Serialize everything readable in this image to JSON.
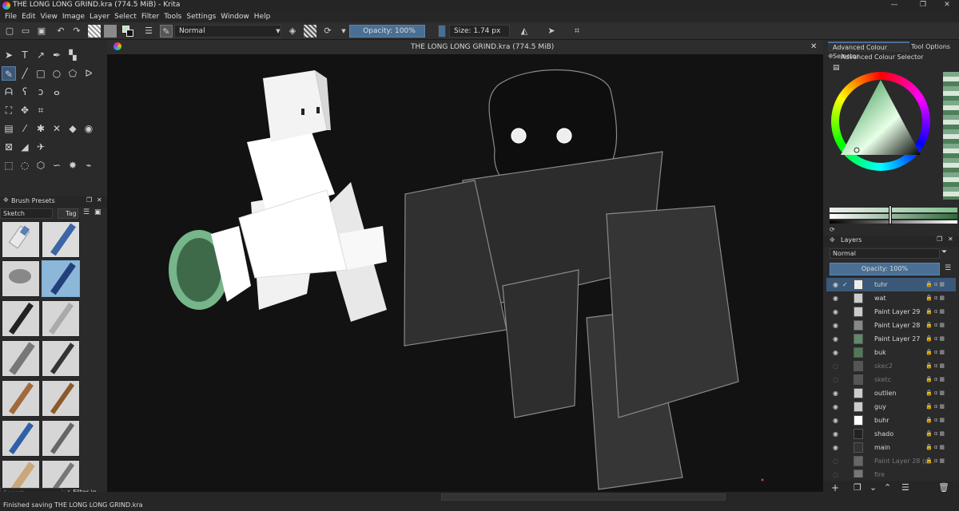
{
  "window": {
    "title": "THE LONG LONG GRIND.kra (774.5 MiB)  - Krita",
    "min_icon": "—",
    "max_icon": "❐",
    "close_icon": "✕"
  },
  "menu": [
    "File",
    "Edit",
    "View",
    "Image",
    "Layer",
    "Select",
    "Filter",
    "Tools",
    "Settings",
    "Window",
    "Help"
  ],
  "toolbar": {
    "blend_mode": "Normal",
    "opacity_label": "Opacity: 100%",
    "size_label": "Size: 1.74 px"
  },
  "canvas": {
    "doc_title": "THE LONG LONG GRIND.kra (774.5 MiB)",
    "close": "✕"
  },
  "brush_presets": {
    "title": "Brush Presets",
    "tag_select": "Sketch",
    "tag_label": "Tag",
    "search_placeholder": "Search",
    "filter_in_tag": "Filter in Tag"
  },
  "colour": {
    "tab_active": "Advanced Colour Selector",
    "tab_other": "Tool Options",
    "panel_title": "Advanced Colour Selector"
  },
  "layers": {
    "title": "Layers",
    "blend_mode": "Normal",
    "opacity_label": "Opacity: 100%",
    "items": [
      {
        "name": "tuhr",
        "visible": true,
        "selected": true
      },
      {
        "name": "wat",
        "visible": true
      },
      {
        "name": "Paint Layer 29",
        "visible": true
      },
      {
        "name": "Paint Layer 28",
        "visible": true
      },
      {
        "name": "Paint Layer 27",
        "visible": true
      },
      {
        "name": "buk",
        "visible": true
      },
      {
        "name": "skec2",
        "visible": false
      },
      {
        "name": "sketc",
        "visible": false
      },
      {
        "name": "outlien",
        "visible": true
      },
      {
        "name": "guy",
        "visible": true
      },
      {
        "name": "buhr",
        "visible": true
      },
      {
        "name": "shado",
        "visible": true
      },
      {
        "name": "main",
        "visible": true
      },
      {
        "name": "Paint Layer 28 (p...",
        "visible": false
      },
      {
        "name": "fire",
        "visible": false
      }
    ]
  },
  "status": {
    "message": "Finished saving THE LONG LONG GRIND.kra"
  },
  "colors": {
    "accent": "#4a6f94",
    "selection": "#3b5878"
  }
}
